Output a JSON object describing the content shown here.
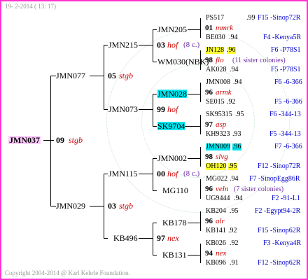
{
  "header": {
    "date": "19- 2-2014 ( 13: 17)"
  },
  "footer": {
    "copyright": "Copyright 2004-2014 @ Karl Kehrle Foundation."
  },
  "root": {
    "id": "JMN037",
    "gen": "09",
    "tag": "stgb"
  },
  "gen1": [
    {
      "id": "JMN077",
      "gen": "05",
      "tag": "stgb"
    },
    {
      "id": "JMN029",
      "gen": "03",
      "tag": "stgb"
    }
  ],
  "gen2": [
    {
      "id": "JMN215",
      "gen": "03",
      "tag": "hof",
      "note": "(8 c.)"
    },
    {
      "id": "JMN073",
      "gen": "99",
      "tag": "hof"
    },
    {
      "id": "JMN115",
      "gen": "00",
      "tag": "hof",
      "note": "(8 c.)"
    },
    {
      "id": "KB496",
      "gen": "97",
      "tag": "nex"
    }
  ],
  "gen3": [
    {
      "id": "JMN205",
      "gen": "01",
      "tag": "mmrk"
    },
    {
      "id": "WM030(NBK)",
      "gen": "98",
      "tag": "flo",
      "note": "(11 sister colonies)"
    },
    {
      "id": "JMN028",
      "gen": "96",
      "tag": "armk"
    },
    {
      "id": "SK9704",
      "gen": "97",
      "tag": "asp"
    },
    {
      "id": "JMN002",
      "gen": "98",
      "tag": "slvg"
    },
    {
      "id": "MG110",
      "gen": "96",
      "tag": "veln",
      "note": "(7 sister colonies)"
    },
    {
      "id": "KB178",
      "gen": "96",
      "tag": "alr"
    },
    {
      "id": "KB131",
      "gen": "94",
      "tag": "nex"
    }
  ],
  "gen4": [
    {
      "id": "PS517",
      "yr": ".99",
      "loc": "F15 -Sinop72R"
    },
    {
      "id": "BE030",
      "yr": ".94",
      "loc": "F4 -Kenya5R"
    },
    {
      "id": "JN128",
      "yr": ".96",
      "loc": "F6 -P78S1"
    },
    {
      "id": "AK028",
      "yr": ".94",
      "loc": "F5 -P78S1"
    },
    {
      "id": "JMN008",
      "yr": ".94",
      "loc": "F6 -6-366"
    },
    {
      "id": "SE015",
      "yr": ".92",
      "loc": "F5 -6-366"
    },
    {
      "id": "SK95315",
      "yr": ".95",
      "loc": "F6 -344-13"
    },
    {
      "id": "KH9323",
      "yr": ".93",
      "loc": "F5 -344-13"
    },
    {
      "id": "JMN009",
      "yr": ".96",
      "loc": "F7 -6-366"
    },
    {
      "id": "OH120",
      "yr": ".95",
      "loc": "F12 -Sinop72R"
    },
    {
      "id": "MG022",
      "yr": ".94",
      "loc": "F7 -SinopEgg86R"
    },
    {
      "id": "UG9444",
      "yr": ".94",
      "loc": "F2 -91-L1"
    },
    {
      "id": "KB204",
      "yr": ".95",
      "loc": "F2 -Egypt94-2R"
    },
    {
      "id": "KB141",
      "yr": ".92",
      "loc": "F15 -Sinop62R"
    },
    {
      "id": "KB026",
      "yr": ".92",
      "loc": "F3 -Kenya4R"
    },
    {
      "id": "KB096",
      "yr": ".91",
      "loc": "F12 -Sinop62R"
    }
  ]
}
